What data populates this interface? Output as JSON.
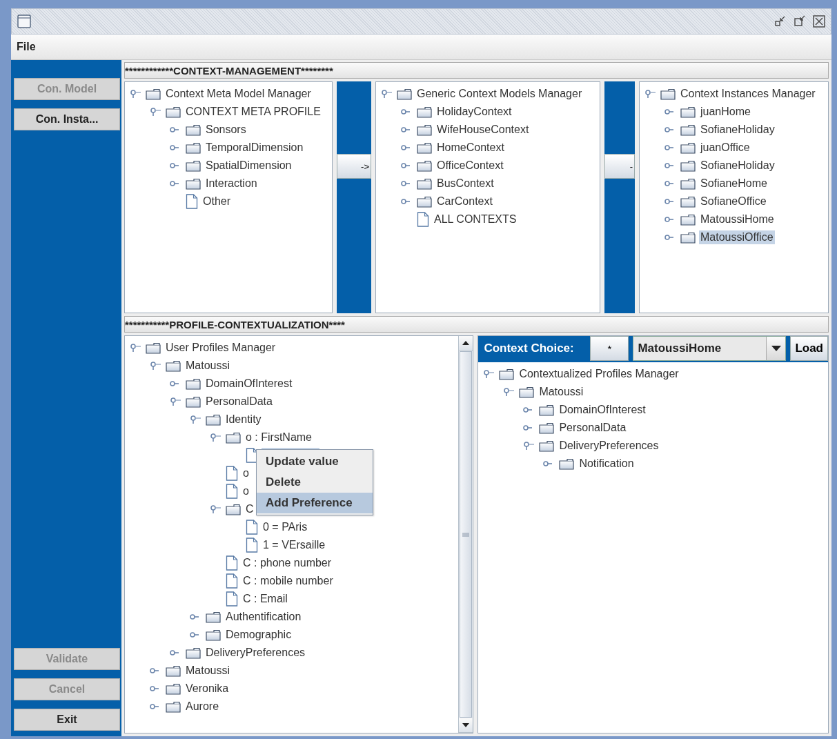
{
  "menu_bar": [
    "File"
  ],
  "sidebar": {
    "top_buttons": [
      {
        "label": "Con. Model",
        "disabled": true
      },
      {
        "label": "Con. Insta...",
        "disabled": false
      }
    ],
    "bottom_buttons": [
      {
        "label": "Validate",
        "disabled": true
      },
      {
        "label": "Cancel",
        "disabled": true
      },
      {
        "label": "Exit",
        "disabled": false
      }
    ]
  },
  "context_management": {
    "header": "************CONTEXT-MANAGEMENT********",
    "transfer_buttons": [
      "->",
      "-"
    ],
    "trees": [
      {
        "label": "Context Meta Model Manager",
        "kind": "folder",
        "expanded": true,
        "children": [
          {
            "label": "CONTEXT META PROFILE",
            "kind": "folder",
            "expanded": true,
            "children": [
              {
                "label": "Sonsors",
                "kind": "folder",
                "expanded": false
              },
              {
                "label": "TemporalDimension",
                "kind": "folder",
                "expanded": false
              },
              {
                "label": "SpatialDimension",
                "kind": "folder",
                "expanded": false
              },
              {
                "label": "Interaction",
                "kind": "folder",
                "expanded": false
              },
              {
                "label": "Other",
                "kind": "file"
              }
            ]
          }
        ]
      },
      {
        "label": "Generic Context Models Manager",
        "kind": "folder",
        "expanded": true,
        "children": [
          {
            "label": "HolidayContext",
            "kind": "folder",
            "expanded": false
          },
          {
            "label": "WifeHouseContext",
            "kind": "folder",
            "expanded": false
          },
          {
            "label": "HomeContext",
            "kind": "folder",
            "expanded": false
          },
          {
            "label": "OfficeContext",
            "kind": "folder",
            "expanded": false
          },
          {
            "label": "BusContext",
            "kind": "folder",
            "expanded": false
          },
          {
            "label": "CarContext",
            "kind": "folder",
            "expanded": false
          },
          {
            "label": "ALL CONTEXTS",
            "kind": "file"
          }
        ]
      },
      {
        "label": "Context Instances Manager",
        "kind": "folder",
        "expanded": true,
        "children": [
          {
            "label": "juanHome",
            "kind": "folder",
            "expanded": false,
            "selected": false
          },
          {
            "label": "SofianeHoliday",
            "kind": "folder",
            "expanded": false,
            "selected": false
          },
          {
            "label": "juanOffice",
            "kind": "folder",
            "expanded": false,
            "selected": false
          },
          {
            "label": "SofianeHoliday",
            "kind": "folder",
            "expanded": false,
            "selected": false
          },
          {
            "label": "SofianeHome",
            "kind": "folder",
            "expanded": false,
            "selected": false
          },
          {
            "label": "SofianeOffice",
            "kind": "folder",
            "expanded": false,
            "selected": false
          },
          {
            "label": "MatoussiHome",
            "kind": "folder",
            "expanded": false,
            "selected": false
          },
          {
            "label": "MatoussiOffice",
            "kind": "folder",
            "expanded": false,
            "selected": true
          }
        ]
      }
    ]
  },
  "profile_contextualization": {
    "header": "***********PROFILE-CONTEXTUALIZATION****",
    "user_profiles_tree": {
      "label": "User Profiles Manager",
      "kind": "folder",
      "expanded": true,
      "children": [
        {
          "label": "Matoussi",
          "kind": "folder",
          "expanded": true,
          "children": [
            {
              "label": "DomainOfInterest",
              "kind": "folder",
              "expanded": false
            },
            {
              "label": "PersonalData",
              "kind": "folder",
              "expanded": true,
              "children": [
                {
                  "label": "Identity",
                  "kind": "folder",
                  "expanded": true,
                  "children": [
                    {
                      "label": "o : FirstName",
                      "kind": "folder",
                      "expanded": true,
                      "children": [
                        {
                          "kind": "file",
                          "selected": true
                        }
                      ]
                    },
                    {
                      "label": "o",
                      "kind": "file"
                    },
                    {
                      "label": "o",
                      "kind": "file"
                    },
                    {
                      "label": "C",
                      "kind": "folder",
                      "expanded": true,
                      "children": [
                        {
                          "label": "0 = PAris",
                          "kind": "file"
                        },
                        {
                          "label": "1 = VErsaille",
                          "kind": "file"
                        }
                      ]
                    },
                    {
                      "label": "C : phone number",
                      "kind": "file"
                    },
                    {
                      "label": "C : mobile number",
                      "kind": "file"
                    },
                    {
                      "label": "C : Email",
                      "kind": "file"
                    }
                  ]
                },
                {
                  "label": "Authentification",
                  "kind": "folder",
                  "expanded": false
                },
                {
                  "label": "Demographic",
                  "kind": "folder",
                  "expanded": false
                }
              ]
            },
            {
              "label": "DeliveryPreferences",
              "kind": "folder",
              "expanded": false
            }
          ]
        },
        {
          "label": "Matoussi",
          "kind": "folder",
          "expanded": false
        },
        {
          "label": "Veronika",
          "kind": "folder",
          "expanded": false
        },
        {
          "label": "Aurore",
          "kind": "folder",
          "expanded": false
        }
      ]
    },
    "context_menu": [
      {
        "label": "Update value",
        "selected": false
      },
      {
        "label": "Delete",
        "selected": false
      },
      {
        "label": "Add Preference",
        "selected": true
      }
    ],
    "context_choice": {
      "label": "Context Choice:",
      "star_button": "*",
      "combo_value": "MatoussiHome",
      "load_button": "Load"
    },
    "contextualized_tree": {
      "label": "Contextualized Profiles Manager",
      "kind": "folder",
      "expanded": true,
      "children": [
        {
          "label": "Matoussi",
          "kind": "folder",
          "expanded": true,
          "children": [
            {
              "label": "DomainOfInterest",
              "kind": "folder",
              "expanded": false
            },
            {
              "label": "PersonalData",
              "kind": "folder",
              "expanded": false
            },
            {
              "label": "DeliveryPreferences",
              "kind": "folder",
              "expanded": true,
              "children": [
                {
                  "label": "Notification",
                  "kind": "folder",
                  "expanded": false
                }
              ]
            }
          ]
        }
      ]
    }
  }
}
